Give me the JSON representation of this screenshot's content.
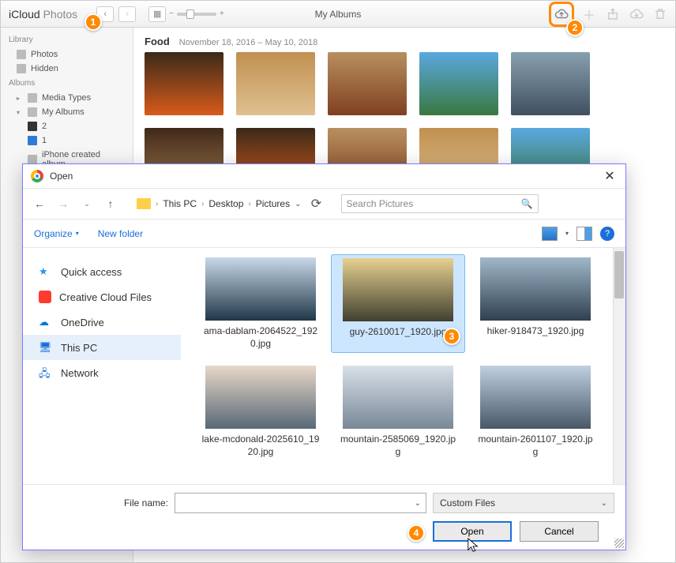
{
  "app": {
    "titleBold": "iCloud",
    "titleLight": "Photos",
    "centerText": "My Albums"
  },
  "sidebar": {
    "sections": {
      "library": "Library",
      "albums": "Albums"
    },
    "items": {
      "photos": "Photos",
      "hidden": "Hidden",
      "mediaTypes": "Media Types",
      "myAlbums": "My Albums",
      "two": "2",
      "one": "1",
      "iphoneAlbum": "iPhone created album"
    }
  },
  "album": {
    "name": "Food",
    "dateRange": "November 18, 2016 – May 10, 2018"
  },
  "dialog": {
    "title": "Open",
    "breadcrumb": [
      "This PC",
      "Desktop",
      "Pictures"
    ],
    "searchPlaceholder": "Search Pictures",
    "organize": "Organize",
    "newFolder": "New folder",
    "sidebarItems": {
      "quickAccess": "Quick access",
      "creativeCloud": "Creative Cloud Files",
      "oneDrive": "OneDrive",
      "thisPC": "This PC",
      "network": "Network"
    },
    "files": [
      "ama-dablam-2064522_1920.jpg",
      "guy-2610017_1920.jpg",
      "hiker-918473_1920.jpg",
      "lake-mcdonald-2025610_1920.jpg",
      "mountain-2585069_1920.jpg",
      "mountain-2601107_1920.jpg"
    ],
    "fileNameLabel": "File name:",
    "filterLabel": "Custom Files",
    "openBtn": "Open",
    "cancelBtn": "Cancel"
  },
  "badges": {
    "b1": "1",
    "b2": "2",
    "b3": "3",
    "b4": "4"
  }
}
